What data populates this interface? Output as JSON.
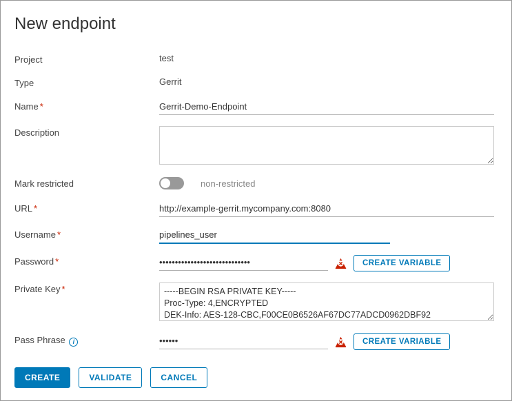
{
  "title": "New endpoint",
  "labels": {
    "project": "Project",
    "type": "Type",
    "name": "Name",
    "description": "Description",
    "mark_restricted": "Mark restricted",
    "url": "URL",
    "username": "Username",
    "password": "Password",
    "private_key": "Private Key",
    "pass_phrase": "Pass Phrase"
  },
  "values": {
    "project": "test",
    "type": "Gerrit",
    "name": "Gerrit-Demo-Endpoint",
    "description": "",
    "restricted": false,
    "restricted_label": "non-restricted",
    "url": "http://example-gerrit.mycompany.com:8080",
    "username": "pipelines_user",
    "password": "•••••••••••••••••••••••••••••",
    "private_key": "-----BEGIN RSA PRIVATE KEY-----\nProc-Type: 4,ENCRYPTED\nDEK-Info: AES-128-CBC,F00CE0B6526AF67DC77ADCD0962DBF92",
    "pass_phrase": "••••••"
  },
  "buttons": {
    "create_variable": "CREATE VARIABLE",
    "create": "CREATE",
    "validate": "VALIDATE",
    "cancel": "CANCEL"
  }
}
